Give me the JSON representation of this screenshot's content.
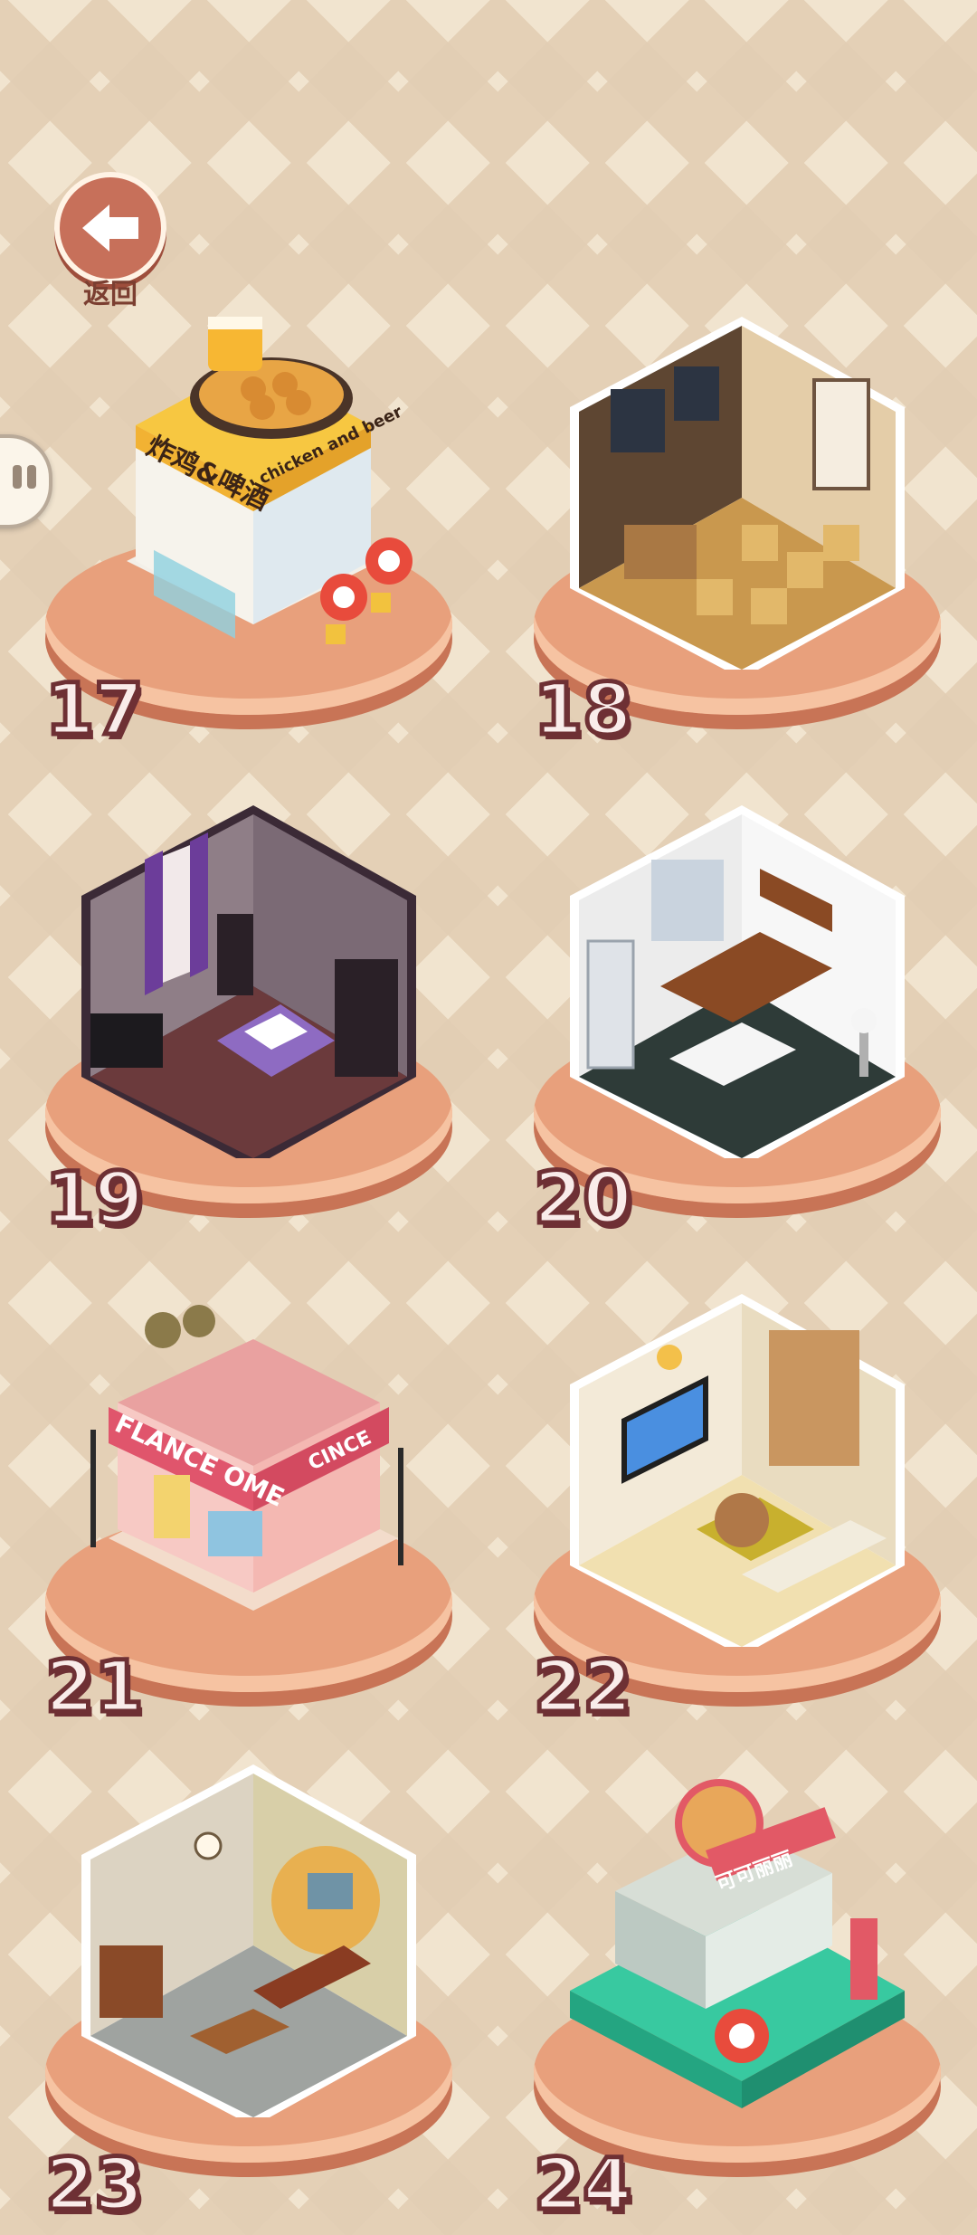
{
  "nav": {
    "back_label": "返回"
  },
  "levels": [
    {
      "number": "17",
      "sign_cn": "炸鸡&啤酒",
      "sign_en": "chicken and beer",
      "theme": "shop"
    },
    {
      "number": "18",
      "theme": "cafe"
    },
    {
      "number": "19",
      "theme": "gothic-bedroom"
    },
    {
      "number": "20",
      "theme": "kitchen"
    },
    {
      "number": "21",
      "sign_en": "FLANCE OME",
      "sign_side": "CINCE",
      "theme": "flower-shop"
    },
    {
      "number": "22",
      "theme": "living-room"
    },
    {
      "number": "23",
      "theme": "vintage-living-room"
    },
    {
      "number": "24",
      "sign_cn": "可可丽丽",
      "theme": "food-truck"
    }
  ],
  "colors": {
    "background": "#f1e4cf",
    "base": "#e8a07c",
    "number_outline": "#6e3034",
    "back_button": "#c7705a"
  }
}
